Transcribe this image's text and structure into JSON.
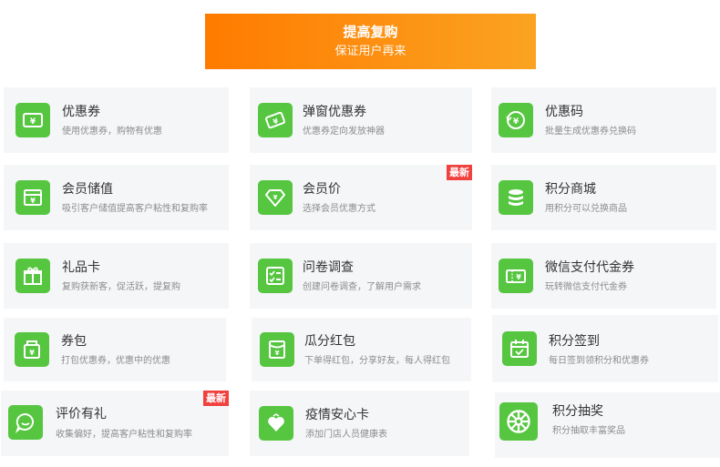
{
  "header": {
    "title": "提高复购",
    "subtitle": "保证用户再来"
  },
  "colors": {
    "accent_start": "#ff7b00",
    "accent_end": "#fba321",
    "icon_green": "#56c641",
    "badge_red": "#f0413f"
  },
  "cards": [
    {
      "title": "优惠券",
      "desc": "使用优惠券，购物有优惠",
      "icon": "coupon-icon"
    },
    {
      "title": "弹窗优惠券",
      "desc": "优惠券定向发放神器",
      "icon": "popup-coupon-icon"
    },
    {
      "title": "优惠码",
      "desc": "批量生成优惠券兑换码",
      "icon": "promo-code-icon"
    },
    {
      "title": "会员储值",
      "desc": "吸引客户储值提高客户粘性和复购率",
      "icon": "member-wallet-icon"
    },
    {
      "title": "会员价",
      "desc": "选择会员优惠方式",
      "icon": "member-price-icon",
      "badge": "最新"
    },
    {
      "title": "积分商城",
      "desc": "用积分可以兑换商品",
      "icon": "points-mall-icon"
    },
    {
      "title": "礼品卡",
      "desc": "复购获新客，促活跃，提复购",
      "icon": "gift-card-icon"
    },
    {
      "title": "问卷调查",
      "desc": "创建问卷调查，了解用户需求",
      "icon": "survey-icon"
    },
    {
      "title": "微信支付代金券",
      "desc": "玩转微信支付代金券",
      "icon": "wechat-voucher-icon"
    },
    {
      "title": "券包",
      "desc": "打包优惠券，优惠中的优惠",
      "icon": "coupon-pack-icon"
    },
    {
      "title": "瓜分红包",
      "desc": "下单得红包，分享好友，每人得红包",
      "icon": "red-packet-icon"
    },
    {
      "title": "积分签到",
      "desc": "每日签到领积分和优惠券",
      "icon": "check-in-calendar-icon"
    },
    {
      "title": "评价有礼",
      "desc": "收集偏好，提高客户粘性和复购率",
      "icon": "review-chat-icon",
      "badge": "最新"
    },
    {
      "title": "疫情安心卡",
      "desc": "添加门店人员健康表",
      "icon": "health-card-icon"
    },
    {
      "title": "积分抽奖",
      "desc": "积分抽取丰富奖品",
      "icon": "points-lottery-icon"
    }
  ]
}
